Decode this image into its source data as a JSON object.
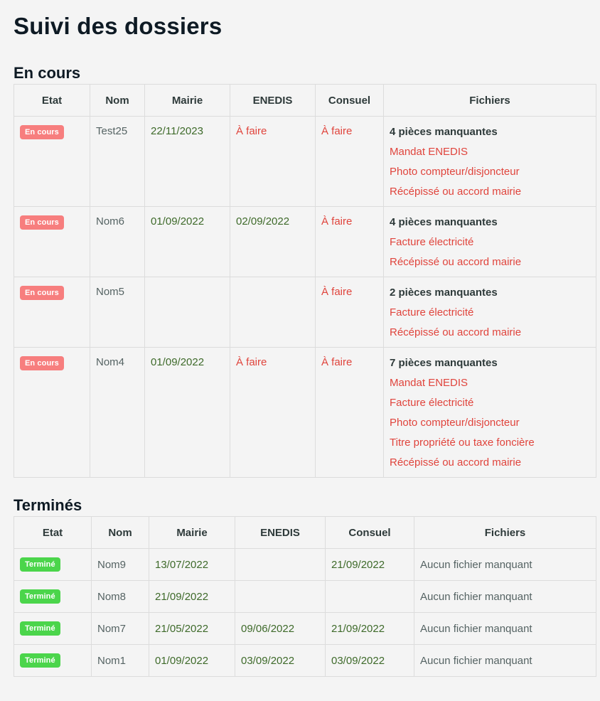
{
  "page": {
    "title": "Suivi des dossiers"
  },
  "sections": {
    "in_progress": {
      "heading": "En cours",
      "columns": [
        "Etat",
        "Nom",
        "Mairie",
        "ENEDIS",
        "Consuel",
        "Fichiers"
      ],
      "rows": [
        {
          "status": "En cours",
          "name": "Test25",
          "mairie": "22/11/2023",
          "enedis": "À faire",
          "consuel": "À faire",
          "files_title": "4 pièces manquantes",
          "files": [
            "Mandat ENEDIS",
            "Photo compteur/disjoncteur",
            "Récépissé ou accord mairie"
          ]
        },
        {
          "status": "En cours",
          "name": "Nom6",
          "mairie": "01/09/2022",
          "enedis": "02/09/2022",
          "consuel": "À faire",
          "files_title": "4 pièces manquantes",
          "files": [
            "Facture électricité",
            "Récépissé ou accord mairie"
          ]
        },
        {
          "status": "En cours",
          "name": "Nom5",
          "mairie": "",
          "enedis": "",
          "consuel": "À faire",
          "files_title": "2 pièces manquantes",
          "files": [
            "Facture électricité",
            "Récépissé ou accord mairie"
          ]
        },
        {
          "status": "En cours",
          "name": "Nom4",
          "mairie": "01/09/2022",
          "enedis": "À faire",
          "consuel": "À faire",
          "files_title": "7 pièces manquantes",
          "files": [
            "Mandat ENEDIS",
            "Facture électricité",
            "Photo compteur/disjoncteur",
            "Titre propriété ou taxe foncière",
            "Récépissé ou accord mairie"
          ]
        }
      ]
    },
    "done": {
      "heading": "Terminés",
      "columns": [
        "Etat",
        "Nom",
        "Mairie",
        "ENEDIS",
        "Consuel",
        "Fichiers"
      ],
      "rows": [
        {
          "status": "Terminé",
          "name": "Nom9",
          "mairie": "13/07/2022",
          "enedis": "",
          "consuel": "21/09/2022",
          "files": "Aucun fichier manquant"
        },
        {
          "status": "Terminé",
          "name": "Nom8",
          "mairie": "21/09/2022",
          "enedis": "",
          "consuel": "",
          "files": "Aucun fichier manquant"
        },
        {
          "status": "Terminé",
          "name": "Nom7",
          "mairie": "21/05/2022",
          "enedis": "09/06/2022",
          "consuel": "21/09/2022",
          "files": "Aucun fichier manquant"
        },
        {
          "status": "Terminé",
          "name": "Nom1",
          "mairie": "01/09/2022",
          "enedis": "03/09/2022",
          "consuel": "03/09/2022",
          "files": "Aucun fichier manquant"
        }
      ]
    }
  },
  "colors": {
    "badge_in_progress": "#f77e7e",
    "badge_done": "#4bd54b",
    "todo_text": "#e0443c",
    "date_text": "#3e6a2a"
  }
}
